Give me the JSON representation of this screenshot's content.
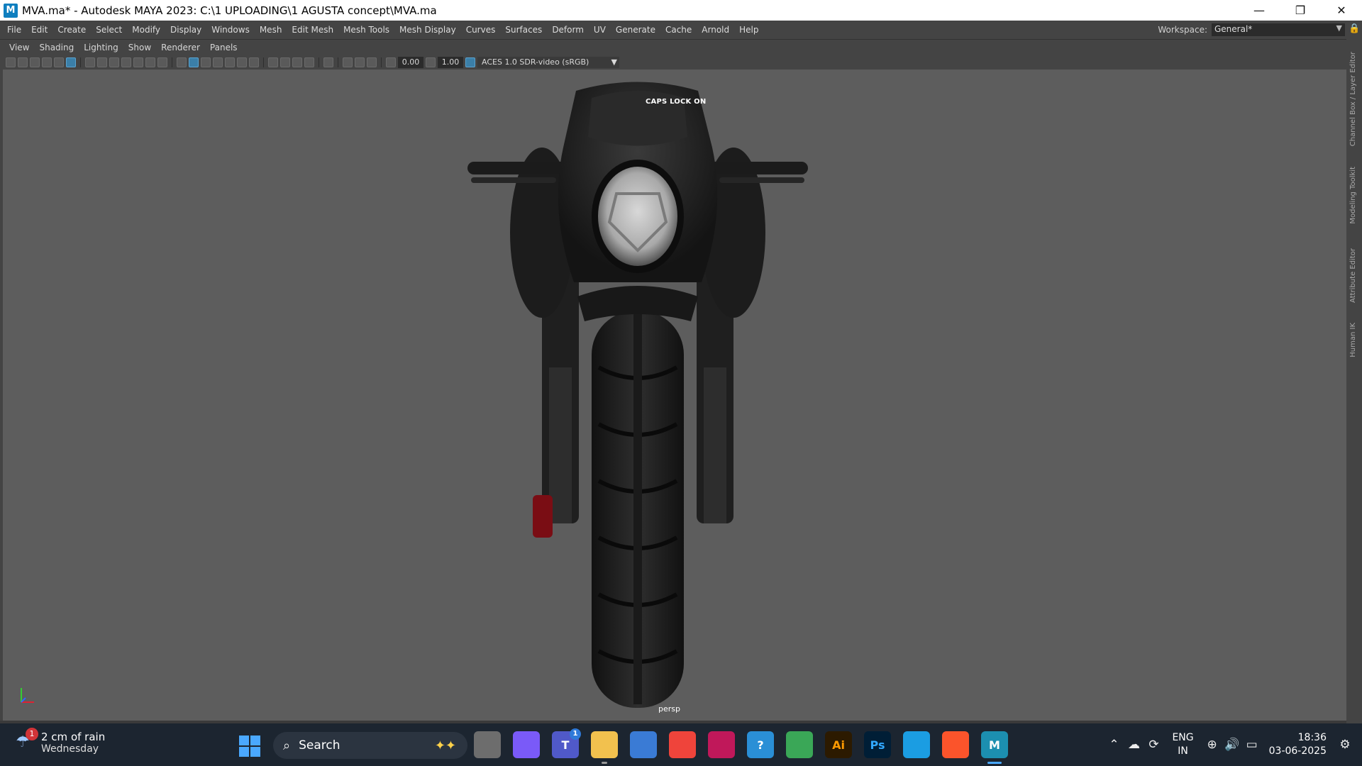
{
  "window": {
    "title": "MVA.ma* - Autodesk MAYA 2023: C:\\1 UPLOADING\\1 AGUSTA concept\\MVA.ma",
    "app_icon": "M",
    "controls": {
      "minimize": "—",
      "restore": "❐",
      "close": "✕"
    }
  },
  "menubar": {
    "items": [
      "File",
      "Edit",
      "Create",
      "Select",
      "Modify",
      "Display",
      "Windows",
      "Mesh",
      "Edit Mesh",
      "Mesh Tools",
      "Mesh Display",
      "Curves",
      "Surfaces",
      "Deform",
      "UV",
      "Generate",
      "Cache",
      "Arnold",
      "Help"
    ],
    "workspace_label": "Workspace:",
    "workspace_value": "General*"
  },
  "panel": {
    "menu": [
      "View",
      "Shading",
      "Lighting",
      "Show",
      "Renderer",
      "Panels"
    ],
    "exposure": "0.00",
    "gamma": "1.00",
    "color_space": "ACES 1.0 SDR-video (sRGB)"
  },
  "viewport": {
    "caps_lock": "CAPS LOCK ON",
    "camera": "persp"
  },
  "side_tabs": [
    "Channel Box / Layer Editor",
    "Modeling Toolkit",
    "Attribute Editor",
    "Human IK"
  ],
  "taskbar": {
    "weather_badge": "1",
    "weather_line1": "2 cm of rain",
    "weather_line2": "Wednesday",
    "search_label": "Search",
    "apps": [
      {
        "name": "task-view",
        "label": "",
        "color": "#6d6d6d"
      },
      {
        "name": "copilot",
        "label": "",
        "color": "#7a5af8"
      },
      {
        "name": "teams",
        "label": "T",
        "color": "#5059c9",
        "badge": "1"
      },
      {
        "name": "file-explorer",
        "label": "",
        "color": "#f2c14e"
      },
      {
        "name": "microsoft-store",
        "label": "",
        "color": "#3a7bd5"
      },
      {
        "name": "anydesk",
        "label": "",
        "color": "#ef443b"
      },
      {
        "name": "forza",
        "label": "",
        "color": "#c0185a"
      },
      {
        "name": "help",
        "label": "?",
        "color": "#2a8fd6"
      },
      {
        "name": "chrome",
        "label": "",
        "color": "#3aa757"
      },
      {
        "name": "illustrator",
        "label": "Ai",
        "color": "#2c1a00"
      },
      {
        "name": "photoshop",
        "label": "Ps",
        "color": "#001e36"
      },
      {
        "name": "edge",
        "label": "",
        "color": "#1b9de2"
      },
      {
        "name": "brave",
        "label": "",
        "color": "#fb542b"
      },
      {
        "name": "maya",
        "label": "M",
        "color": "#1c8fb0",
        "active": true
      }
    ],
    "lang_top": "ENG",
    "lang_bottom": "IN",
    "time": "18:36",
    "date": "03-06-2025"
  }
}
